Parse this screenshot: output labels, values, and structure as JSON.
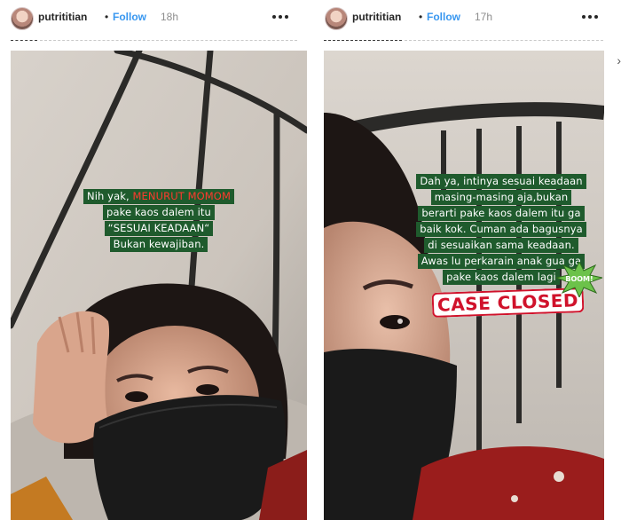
{
  "stories": [
    {
      "username": "putrititian",
      "separator": "•",
      "follow_label": "Follow",
      "time": "18h",
      "caption": {
        "line1_prefix": "Nih yak,",
        "line1_highlight": "MENURUT MOMOM",
        "line2": "pake kaos dalem itu",
        "line3": "“SESUAI KEADAAN“",
        "line4": "Bukan kewajiban."
      }
    },
    {
      "username": "putrititian",
      "separator": "•",
      "follow_label": "Follow",
      "time": "17h",
      "caption": {
        "lines": [
          "Dah ya, intinya sesuai keadaan",
          "masing-masing aja,bukan",
          "berarti pake kaos dalem itu ga",
          "baik kok. Cuman ada bagusnya",
          "di sesuaikan sama keadaan.",
          "Awas lu perkarain anak gua ga",
          "pake kaos dalem lagi"
        ]
      },
      "sticker_text": "CASE CLOSED",
      "boom_text": "BOOM!"
    }
  ],
  "icons": {
    "more": "more-horizontal-icon",
    "next": "chevron-right-icon"
  },
  "colors": {
    "caption_bg": "#1f5b2d",
    "caption_highlight": "#ff3a2e",
    "follow": "#3897f0",
    "case_closed": "#d0122b"
  }
}
